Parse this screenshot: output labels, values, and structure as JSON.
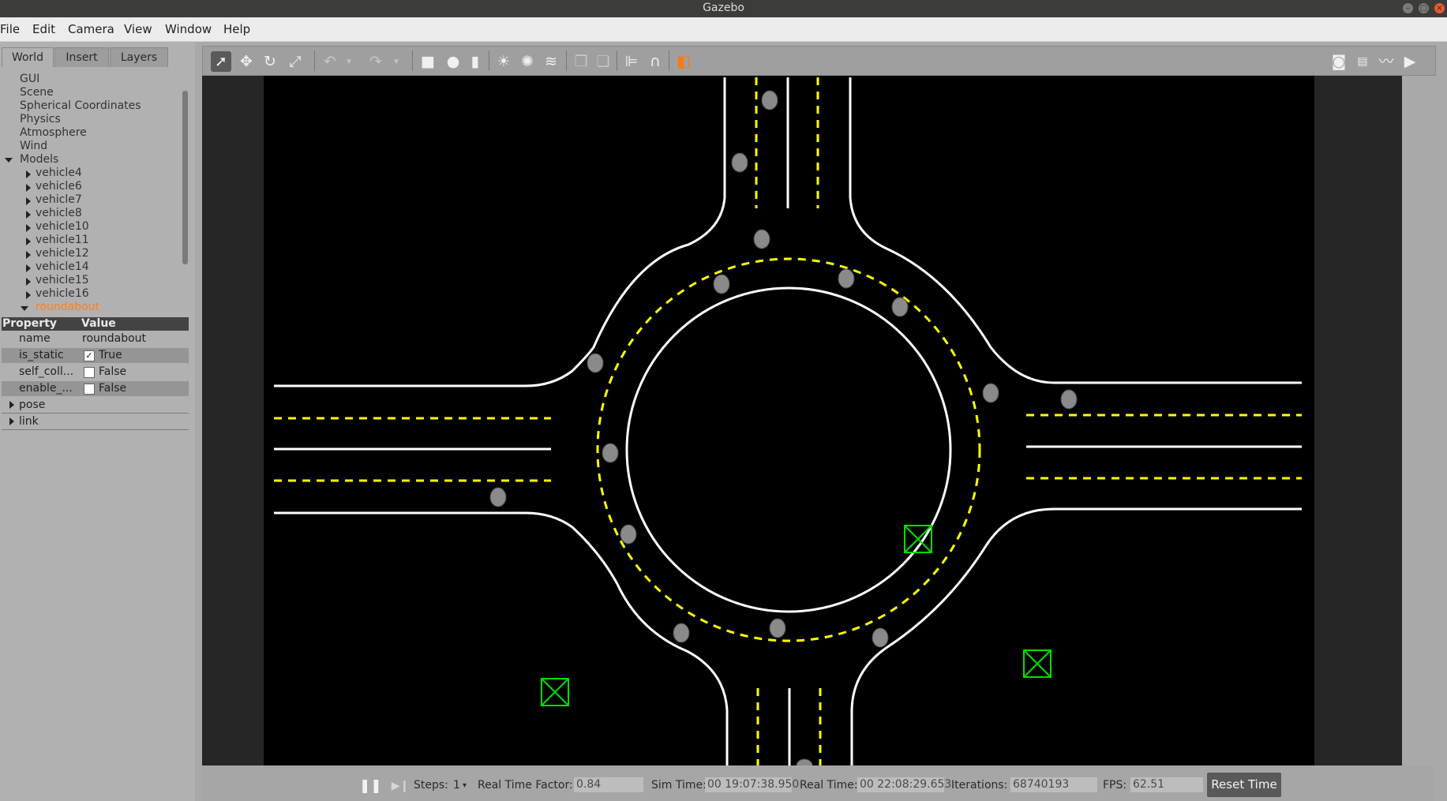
{
  "window": {
    "title": "Gazebo"
  },
  "menu": [
    "File",
    "Edit",
    "Camera",
    "View",
    "Window",
    "Help"
  ],
  "tabs": [
    "World",
    "Insert",
    "Layers"
  ],
  "tree": {
    "world_items": [
      "GUI",
      "Scene",
      "Spherical Coordinates",
      "Physics",
      "Atmosphere",
      "Wind"
    ],
    "models_label": "Models",
    "models": [
      "vehicle4",
      "vehicle6",
      "vehicle7",
      "vehicle8",
      "vehicle10",
      "vehicle11",
      "vehicle12",
      "vehicle14",
      "vehicle15",
      "vehicle16"
    ],
    "selected_model": "roundabout",
    "selected_color": "#ff7f1e"
  },
  "properties": {
    "header_property": "Property",
    "header_value": "Value",
    "rows": [
      {
        "key": "name",
        "value": "roundabout",
        "checkbox": false,
        "checked": false
      },
      {
        "key": "is_static",
        "value": "True",
        "checkbox": true,
        "checked": true
      },
      {
        "key": "self_coll...",
        "value": "False",
        "checkbox": true,
        "checked": false
      },
      {
        "key": "enable_...",
        "value": "False",
        "checkbox": true,
        "checked": false
      }
    ],
    "groups": [
      "pose",
      "link"
    ]
  },
  "toolbar": {
    "left_tools": [
      "select-mode",
      "translate-mode",
      "rotate-mode",
      "scale-mode",
      "undo",
      "redo",
      "box-shape",
      "sphere-shape",
      "cylinder-shape",
      "point-light",
      "spot-light",
      "directional-light",
      "copy",
      "paste",
      "align",
      "snap",
      "change-view"
    ],
    "right_tools": [
      "screenshot",
      "log",
      "plot",
      "video"
    ]
  },
  "status": {
    "steps_label": "Steps:",
    "steps_value": "1",
    "rtf_label": "Real Time Factor:",
    "rtf_value": "0.84",
    "sim_time_label": "Sim Time:",
    "sim_time_value": "00 19:07:38.950",
    "real_time_label": "Real Time:",
    "real_time_value": "00 22:08:29.653",
    "iterations_label": "Iterations:",
    "iterations_value": "68740193",
    "fps_label": "FPS:",
    "fps_value": "62.51",
    "reset_label": "Reset Time"
  },
  "scene_colors": {
    "road_line": "#ffffff",
    "lane_dash": "#ffff00",
    "marker": "#00e000",
    "vehicle": "#8a8a8a"
  }
}
